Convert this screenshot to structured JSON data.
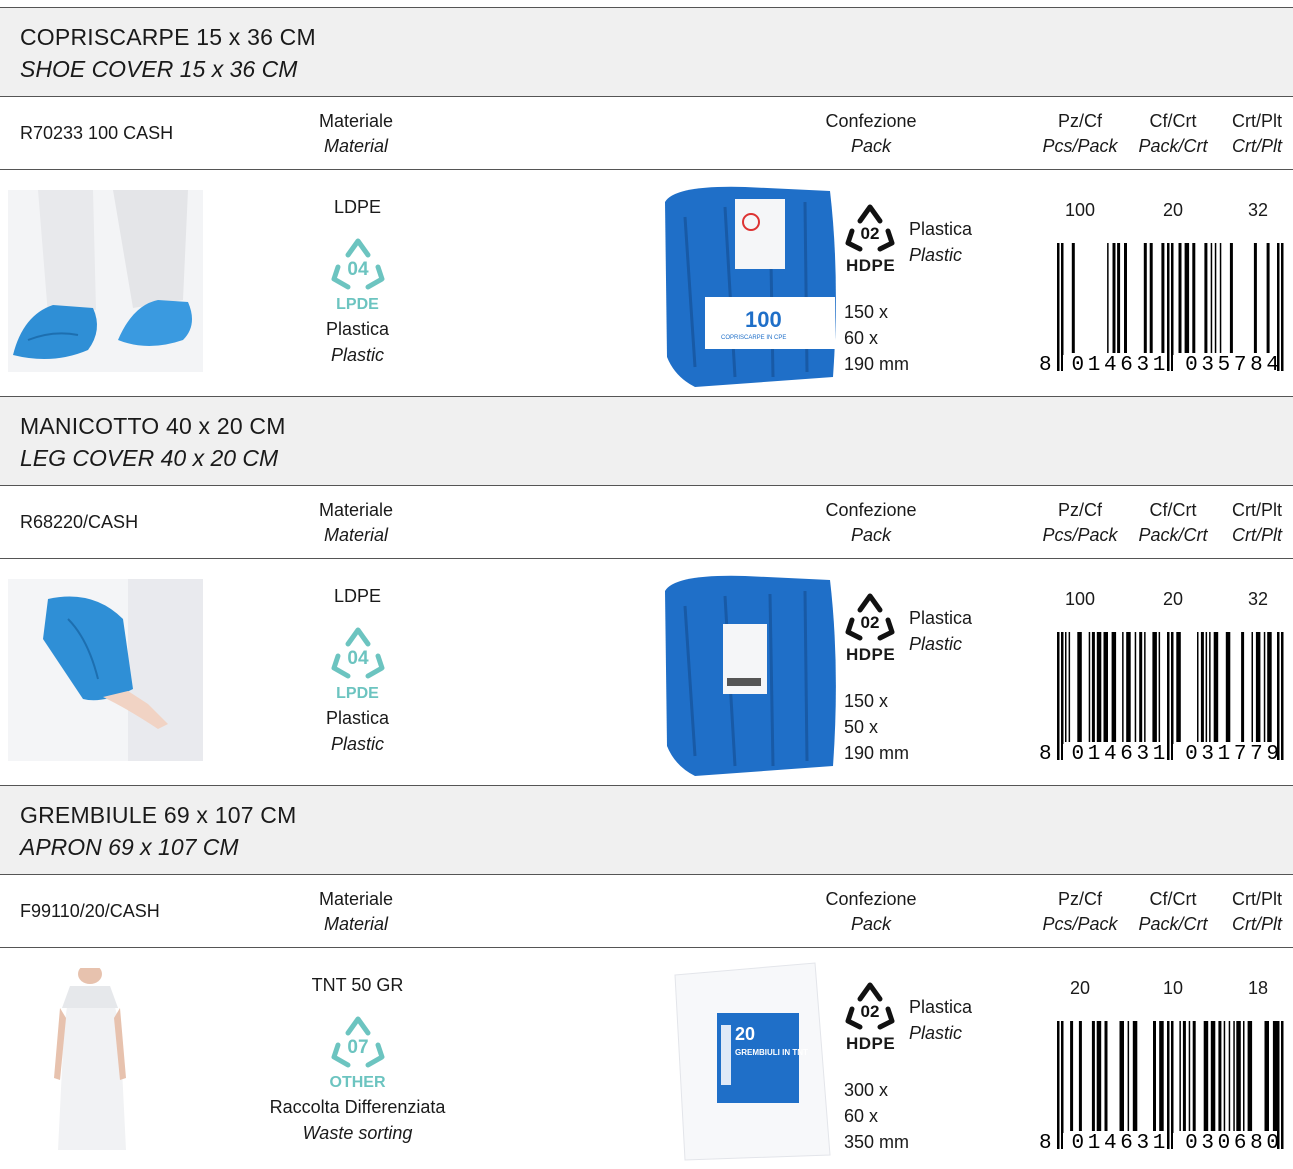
{
  "sections": [
    {
      "title_it": "COPRISCARPE 15 x 36 CM",
      "title_en": "SHOE COVER 15 x 36 CM",
      "code": "R70233 100 CASH",
      "material": "LDPE",
      "recycle_number": "04",
      "recycle_label": "LPDE",
      "material_it": "Plastica",
      "material_en": "Plastic",
      "pack_recycle_number": "02",
      "pack_recycle_label": "HDPE",
      "pack_it": "Plastica",
      "pack_en": "Plastic",
      "dims": [
        "150 x",
        "60 x",
        "190 mm"
      ],
      "pz_cf": "100",
      "cf_crt": "20",
      "crt_plt": "32",
      "barcode_digits": "8 014631 035784",
      "pack_label": "100",
      "pack_sublabel": "COPRISCARPE IN CPE"
    },
    {
      "title_it": "MANICOTTO 40 x 20 CM",
      "title_en": "LEG COVER 40 x 20 CM",
      "code": "R68220/CASH",
      "material": "LDPE",
      "recycle_number": "04",
      "recycle_label": "LPDE",
      "material_it": "Plastica",
      "material_en": "Plastic",
      "pack_recycle_number": "02",
      "pack_recycle_label": "HDPE",
      "pack_it": "Plastica",
      "pack_en": "Plastic",
      "dims": [
        "150 x",
        "50 x",
        "190 mm"
      ],
      "pz_cf": "100",
      "cf_crt": "20",
      "crt_plt": "32",
      "barcode_digits": "8 014631 031779",
      "pack_label": "",
      "pack_sublabel": ""
    },
    {
      "title_it": "GREMBIULE 69 x 107 CM",
      "title_en": "APRON 69 x 107 CM",
      "code": "F99110/20/CASH",
      "material": "TNT 50 GR",
      "recycle_number": "07",
      "recycle_label": "OTHER",
      "material_it": "Raccolta Differenziata",
      "material_en": "Waste sorting",
      "pack_recycle_number": "02",
      "pack_recycle_label": "HDPE",
      "pack_it": "Plastica",
      "pack_en": "Plastic",
      "dims": [
        "300 x",
        "60 x",
        "350 mm"
      ],
      "pz_cf": "20",
      "cf_crt": "10",
      "crt_plt": "18",
      "barcode_digits": "8 014631 030680",
      "pack_label": "20",
      "pack_sublabel": "GREMBIULI IN TNT"
    }
  ],
  "headers": {
    "materiale_it": "Materiale",
    "materiale_en": "Material",
    "confezione_it": "Confezione",
    "confezione_en": "Pack",
    "pz_cf_it": "Pz/Cf",
    "pz_cf_en": "Pcs/Pack",
    "cf_crt_it": "Cf/Crt",
    "cf_crt_en": "Pack/Crt",
    "crt_plt_it": "Crt/Plt",
    "crt_plt_en": "Crt/Plt"
  },
  "colors": {
    "band": "#f0f0f0",
    "recycle_teal": "#6cc4c0",
    "product_blue": "#2f8fd6",
    "pack_blue": "#1f6fc8"
  }
}
